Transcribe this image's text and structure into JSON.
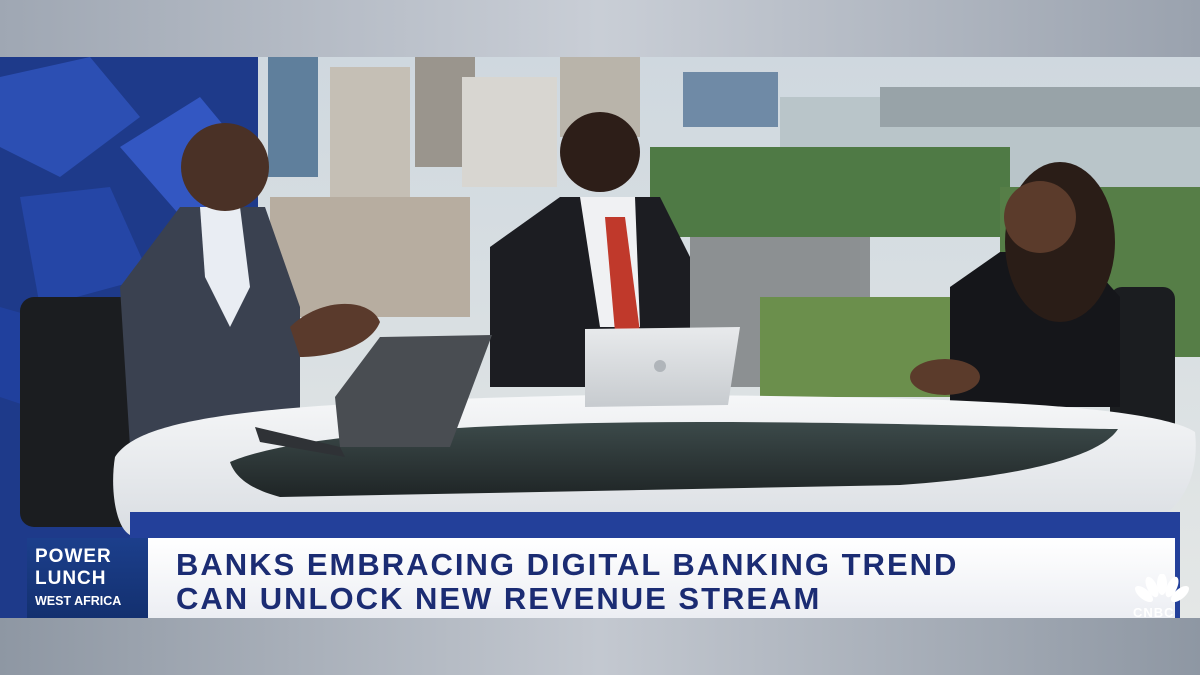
{
  "broadcast": {
    "show": {
      "line1": "POWER",
      "line2": "LUNCH",
      "region": "WEST AFRICA"
    },
    "headline": {
      "line1": "BANKS EMBRACING DIGITAL BANKING TREND",
      "line2": "CAN UNLOCK NEW REVENUE STREAM"
    },
    "network": {
      "name": "CNBC",
      "logo_icon": "peacock-icon"
    }
  },
  "colors": {
    "show_box": "#1c3f8c",
    "headline_text": "#1b2c73",
    "headline_bg": "#ffffff"
  }
}
